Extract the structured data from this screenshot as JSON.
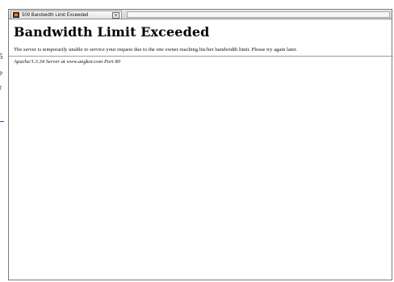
{
  "window": {
    "tab_title": "509 Bandwidth Limit Exceeded",
    "close_symbol": "×"
  },
  "page": {
    "heading": "Bandwidth Limit Exceeded",
    "message": "The server is temporarily unable to service your request due to the site owner reaching his/her bandwidth limit. Please try again later.",
    "address": "Apache/1.3.34 Server at www.angkor.com Port 80"
  },
  "left_fragment": {
    "chars": [
      "5",
      "e",
      "r"
    ]
  }
}
